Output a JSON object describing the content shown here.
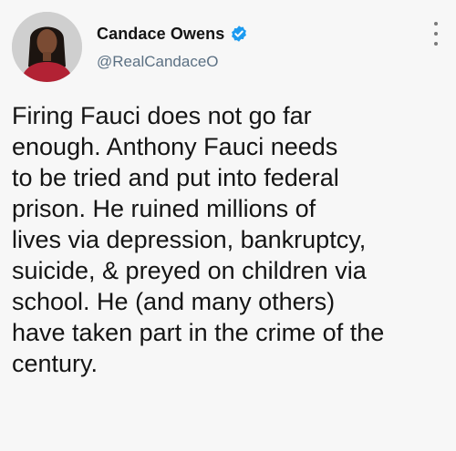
{
  "author": {
    "display_name": "Candace Owens",
    "handle": "@RealCandaceO",
    "verified": true,
    "avatar_icon": "profile-photo"
  },
  "tweet": {
    "lines": [
      "Firing Fauci does not go far",
      "enough. Anthony Fauci needs",
      "to be tried and put into federal",
      "prison. He ruined millions of",
      "lives via depression, bankruptcy,",
      "suicide, & preyed on children via",
      "school. He (and many others)",
      "have taken part in the crime of the",
      "century."
    ]
  },
  "menu": {
    "icon": "more-vertical-icon"
  },
  "colors": {
    "verified_badge": "#1d9bf0",
    "handle": "#5b7083",
    "text": "#141414"
  }
}
